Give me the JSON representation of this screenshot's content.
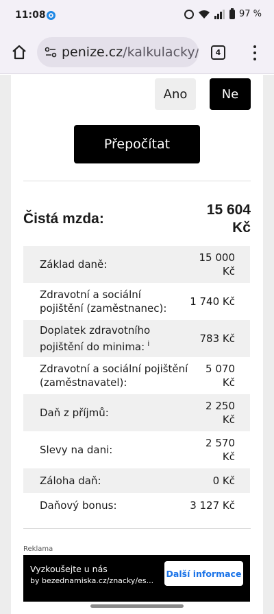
{
  "status_bar": {
    "time": "11:08",
    "battery": "97 %",
    "icons": [
      "app-icon",
      "alarm-icon",
      "wifi-icon",
      "signal-icon",
      "battery-icon"
    ]
  },
  "browser": {
    "url_host": "penize.cz",
    "url_path": "/kalkulacky/",
    "tab_count": "4",
    "icons": [
      "home-icon",
      "site-settings-icon",
      "tabs-icon",
      "more-vert-icon"
    ]
  },
  "toggle": {
    "yes_label": "Ano",
    "no_label": "Ne",
    "selected": "Ne"
  },
  "recalc_label": "Přepočítat",
  "result": {
    "net_label": "Čistá mzda:",
    "net_value_line1": "15 604",
    "net_value_line2": "Kč"
  },
  "breakdown": [
    {
      "label": "Základ daně:",
      "value": "15 000 Kč"
    },
    {
      "label": "Zdravotní a sociální pojištění (zaměstnanec):",
      "value": "1 740 Kč"
    },
    {
      "label": "Doplatek zdravotního pojištění do minima:",
      "value": "783 Kč",
      "info": "i"
    },
    {
      "label": "Zdravotní a sociální pojištění (zaměstnavatel):",
      "value": "5 070 Kč"
    },
    {
      "label": "Daň z příjmů:",
      "value": "2 250 Kč"
    },
    {
      "label": "Slevy na dani:",
      "value": "2 570 Kč"
    },
    {
      "label": "Záloha daň:",
      "value": "0 Kč"
    },
    {
      "label": "Daňový bonus:",
      "value": "3 127 Kč"
    }
  ],
  "ad": {
    "label": "Reklama",
    "title": "Vyzkoušejte u nás",
    "url": "by bezednamiska.cz/znacky/es...",
    "cta": "Další informace"
  },
  "colors": {
    "accent": "#000000",
    "browser_bg": "#f3f0f7",
    "link": "#1a73e8"
  }
}
